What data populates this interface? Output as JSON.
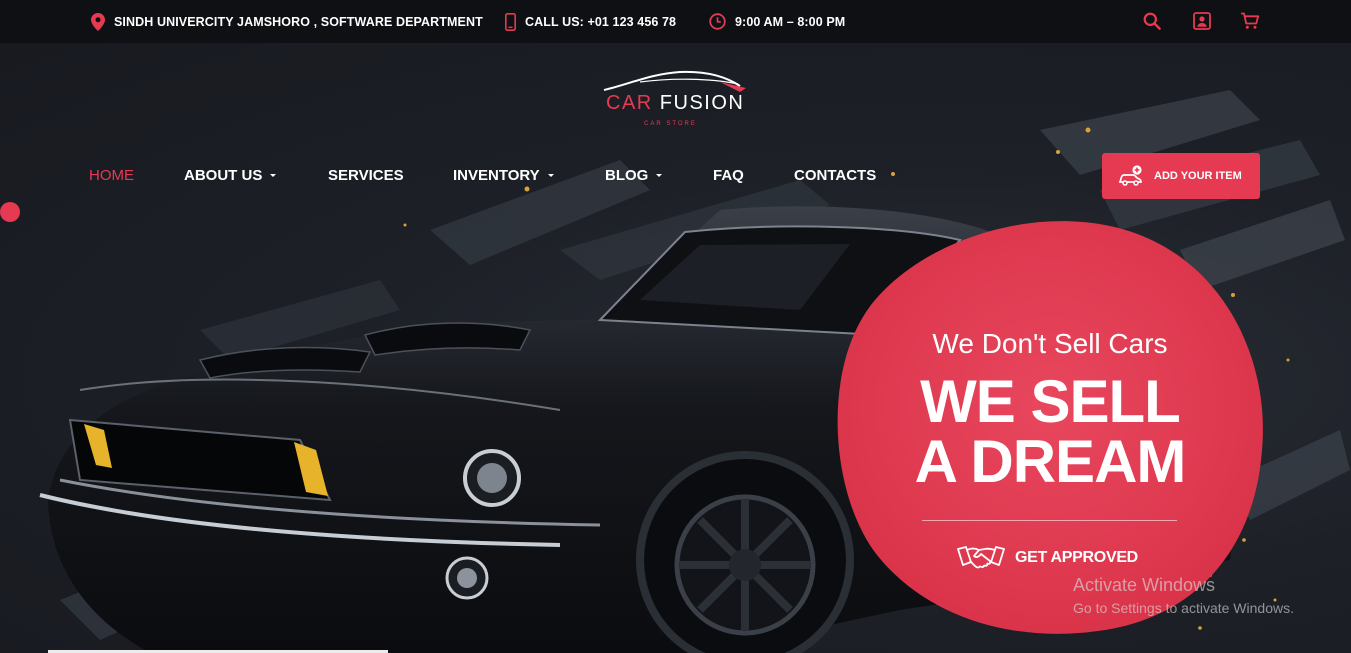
{
  "topbar": {
    "address": "SINDH UNIVERCITY JAMSHORO , SOFTWARE DEPARTMENT",
    "phone": "CALL US: +01 123 456 78",
    "hours": "9:00 AM – 8:00 PM",
    "icons": [
      "location-pin-icon",
      "phone-icon",
      "clock-icon",
      "search-icon",
      "user-icon",
      "cart-icon"
    ]
  },
  "logo": {
    "word1": "CAR",
    "word2": "FUSION",
    "tagline": "CAR STORE"
  },
  "nav": {
    "items": [
      {
        "label": "HOME",
        "active": true,
        "dropdown": false
      },
      {
        "label": "ABOUT US",
        "active": false,
        "dropdown": true
      },
      {
        "label": "SERVICES",
        "active": false,
        "dropdown": false
      },
      {
        "label": "INVENTORY",
        "active": false,
        "dropdown": true
      },
      {
        "label": "BLOG",
        "active": false,
        "dropdown": true
      },
      {
        "label": "FAQ",
        "active": false,
        "dropdown": false
      },
      {
        "label": "CONTACTS",
        "active": false,
        "dropdown": false
      }
    ],
    "add_button_label": "ADD YOUR ITEM"
  },
  "hero": {
    "subtitle": "We Don't Sell Cars",
    "title_line1": "WE SELL",
    "title_line2": "A DREAM",
    "cta_label": "GET APPROVED"
  },
  "watermark": {
    "line1": "Activate Windows",
    "line2": "Go to Settings to activate Windows."
  },
  "colors": {
    "accent": "#e63a52",
    "topbar_bg": "#0e1013",
    "hero_bg": "#1d2027"
  }
}
